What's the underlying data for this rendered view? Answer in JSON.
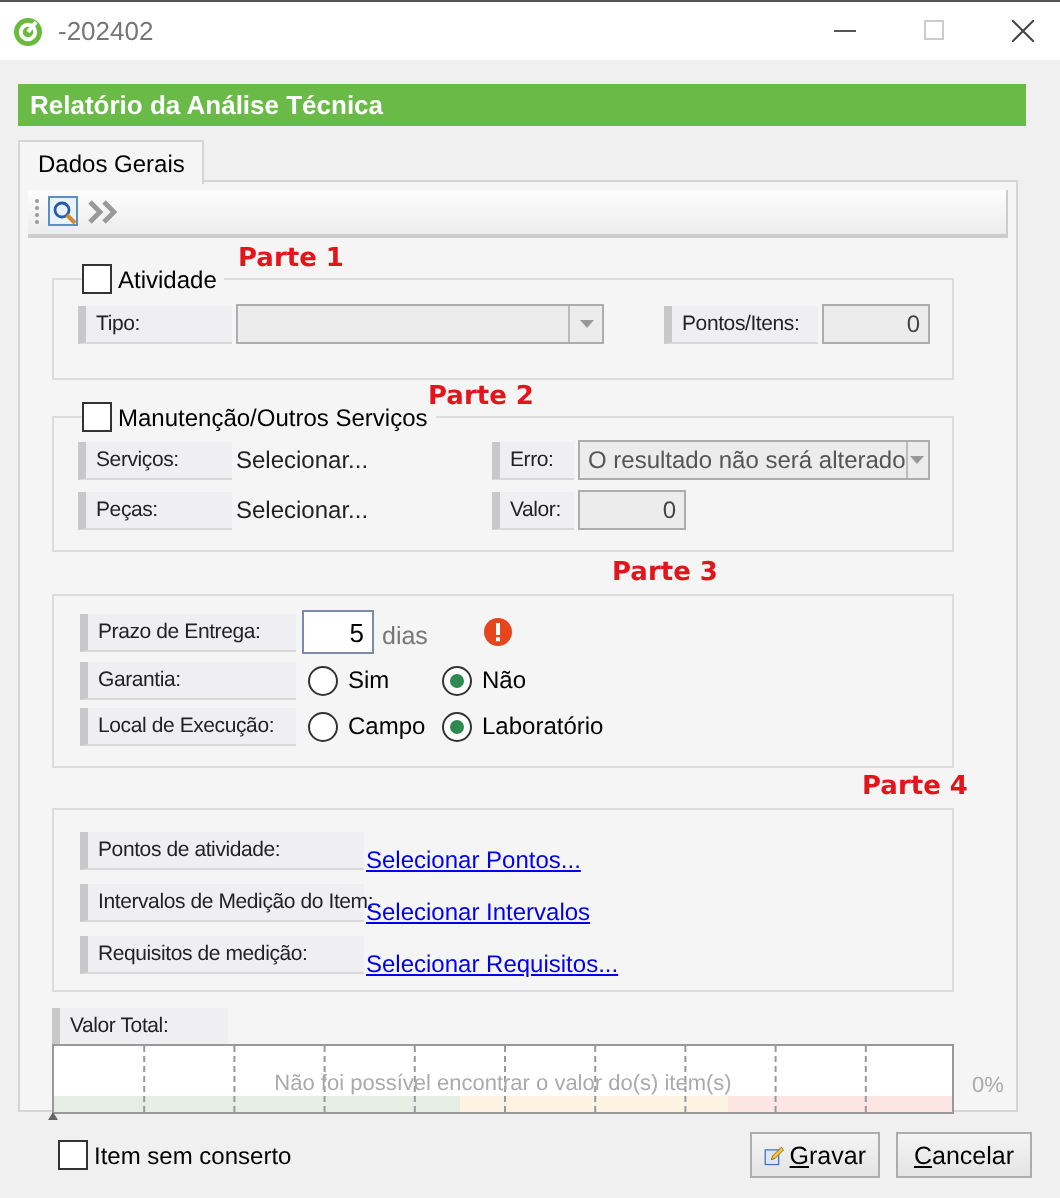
{
  "window": {
    "title": "-202402"
  },
  "header": {
    "title": "Relatório da Análise Técnica"
  },
  "tabs": [
    {
      "label": "Dados Gerais",
      "selected": true
    }
  ],
  "parte1": {
    "marker": "Parte 1",
    "toggle": {
      "label": "Atividade",
      "checked": false
    },
    "tipo": {
      "label": "Tipo:",
      "disabled": true
    },
    "pontos_itens": {
      "label": "Pontos/Itens:",
      "value": "0",
      "disabled": true
    }
  },
  "parte2": {
    "marker": "Parte 2",
    "toggle": {
      "label": "Manutenção/Outros Serviços",
      "checked": false
    },
    "servicos": {
      "label": "Serviços:",
      "link": "Selecionar..."
    },
    "erro": {
      "label": "Erro:",
      "value": "O resultado não será alterado",
      "disabled": true
    },
    "pecas": {
      "label": "Peças:",
      "link": "Selecionar..."
    },
    "valor": {
      "label": "Valor:",
      "value": "0",
      "disabled": true
    }
  },
  "parte3": {
    "marker": "Parte 3",
    "prazo": {
      "label": "Prazo de Entrega:",
      "value": "5",
      "unit": "dias",
      "warning": true
    },
    "radios": [
      {
        "label": "Garantia:",
        "options": [
          {
            "label": "Sim",
            "selected": false
          },
          {
            "label": "Não",
            "selected": true
          }
        ]
      },
      {
        "label": "Local de Execução:",
        "options": [
          {
            "label": "Campo",
            "selected": false
          },
          {
            "label": "Laboratório",
            "selected": true
          }
        ]
      }
    ]
  },
  "parte4": {
    "marker": "Parte 4",
    "rows": [
      {
        "label": "Pontos de atividade:",
        "link": "Selecionar Pontos..."
      },
      {
        "label": "Intervalos de Medição do Item:",
        "link": "Selecionar Intervalos"
      },
      {
        "label": "Requisitos de medição:",
        "link": "Selecionar Requisitos..."
      }
    ]
  },
  "total": {
    "label": "Valor Total:",
    "message": "Não foi possível encontrar o valor do(s) item(s)",
    "level": 0,
    "reading": "0%"
  },
  "footer": {
    "checkbox": {
      "label": "Item sem conserto",
      "checked": false
    },
    "buttons": [
      {
        "kind": "save",
        "label": "Gravar"
      },
      {
        "kind": "cancel",
        "label": "Cancelar"
      }
    ]
  }
}
